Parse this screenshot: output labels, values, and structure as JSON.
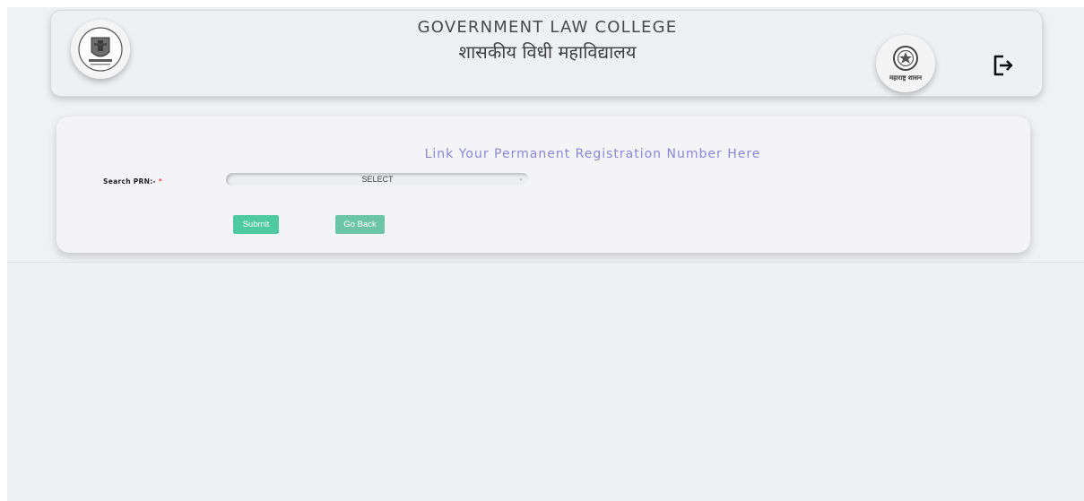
{
  "header": {
    "title_en": "GOVERNMENT LAW COLLEGE",
    "title_mr": "शासकीय विधी महाविद्यालय",
    "logo_left_icon": "college-crest-icon",
    "logo_right_icon": "maharashtra-govt-seal-icon",
    "logo_right_caption": "महाराष्ट्र शासन",
    "logout_icon": "logout-icon"
  },
  "form": {
    "title": "Link Your Permanent Registration Number Here",
    "search_label": "Search PRN:- ",
    "required_mark": "*",
    "select_value": "SELECT",
    "submit_label": "Submit",
    "back_label": "Go Back"
  },
  "colors": {
    "accent_button": "#4fc9a0",
    "title_text": "#8a86d6",
    "required": "#e05252"
  }
}
